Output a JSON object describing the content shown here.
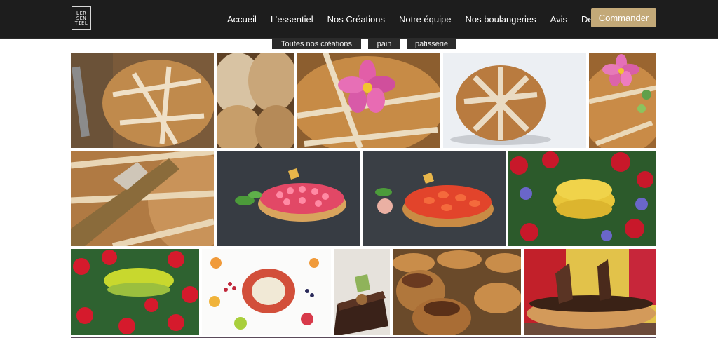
{
  "logo": {
    "line1": "LER",
    "line2": "SEN",
    "line3": "TIEL"
  },
  "nav": {
    "items": [
      "Accueil",
      "L’essentiel",
      "Nos Créations",
      "Notre équipe",
      "Nos boulangeries",
      "Avis",
      "Devis"
    ],
    "cta": "Commander"
  },
  "filters": [
    "Toutes nos créations",
    "pain",
    "patisserie"
  ],
  "gallery": [
    "bread-with-knife",
    "sliced-bread",
    "bread-with-pink-flower",
    "bread-on-white",
    "bread-flower-closeup",
    "bread-knife-closeup",
    "raspberry-tart",
    "strawberry-tart",
    "yellow-macaron-flowers",
    "green-macaron-flowers",
    "macaron-plate",
    "chocolate-entremet",
    "pastry-assortment",
    "chocolate-tart"
  ]
}
